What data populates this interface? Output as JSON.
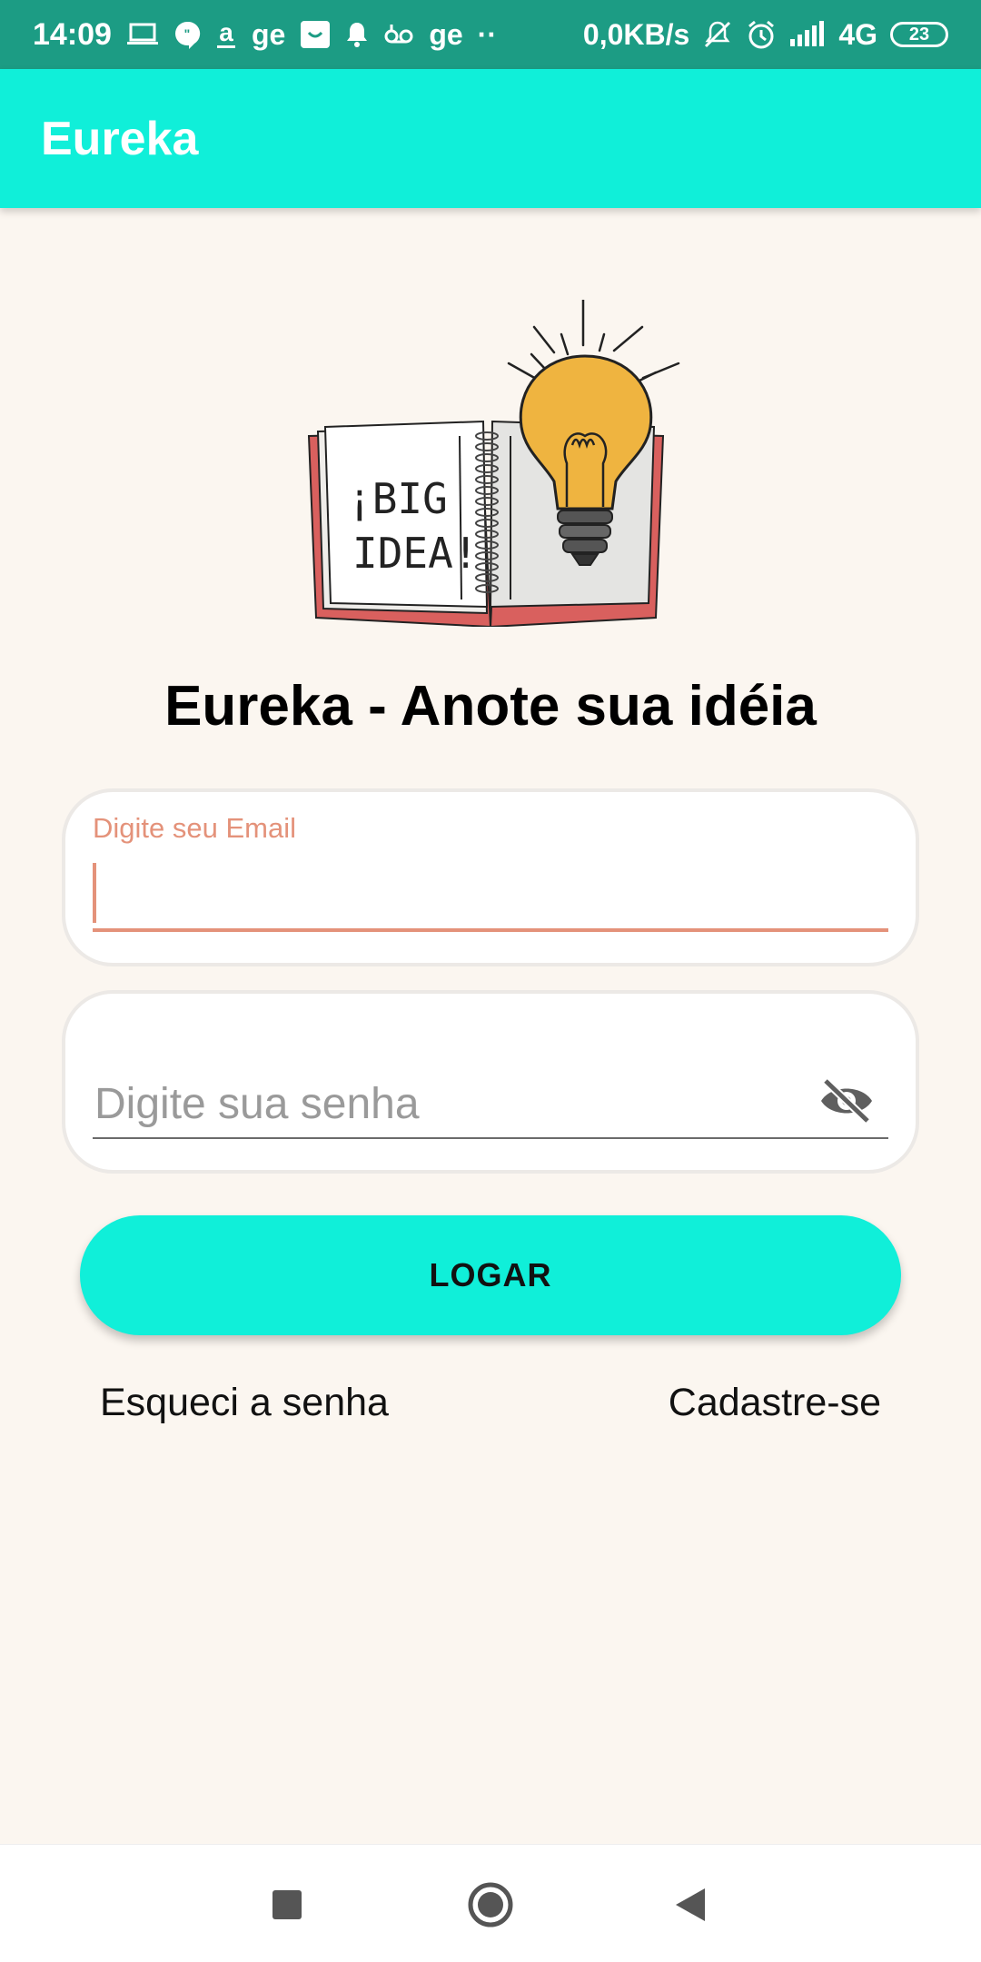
{
  "status_bar": {
    "time": "14:09",
    "notif_text_1": "ge",
    "notif_text_2": "ge",
    "more": "··",
    "network_speed": "0,0KB/s",
    "network_type": "4G",
    "battery": "23",
    "icons": [
      "laptop-icon",
      "chat-icon",
      "amazon-icon",
      "ge-text",
      "shopee-icon",
      "bell-icon",
      "voicemail-icon",
      "ge-text",
      "mute-icon",
      "alarm-icon",
      "signal-icon",
      "battery-icon"
    ]
  },
  "app_bar": {
    "title": "Eureka"
  },
  "illustration": {
    "page_text_line1": "¡BIG",
    "page_text_line2": "IDEA!"
  },
  "main": {
    "headline": "Eureka - Anote sua idéia",
    "email": {
      "label": "Digite seu Email",
      "value": ""
    },
    "password": {
      "placeholder": "Digite sua senha",
      "value": ""
    },
    "login_label": "LOGAR",
    "forgot_label": "Esqueci a senha",
    "signup_label": "Cadastre-se"
  },
  "colors": {
    "status_bar": "#1c9c84",
    "accent": "#10efd9",
    "background": "#fbf6f0",
    "error_field": "#e4927a"
  }
}
